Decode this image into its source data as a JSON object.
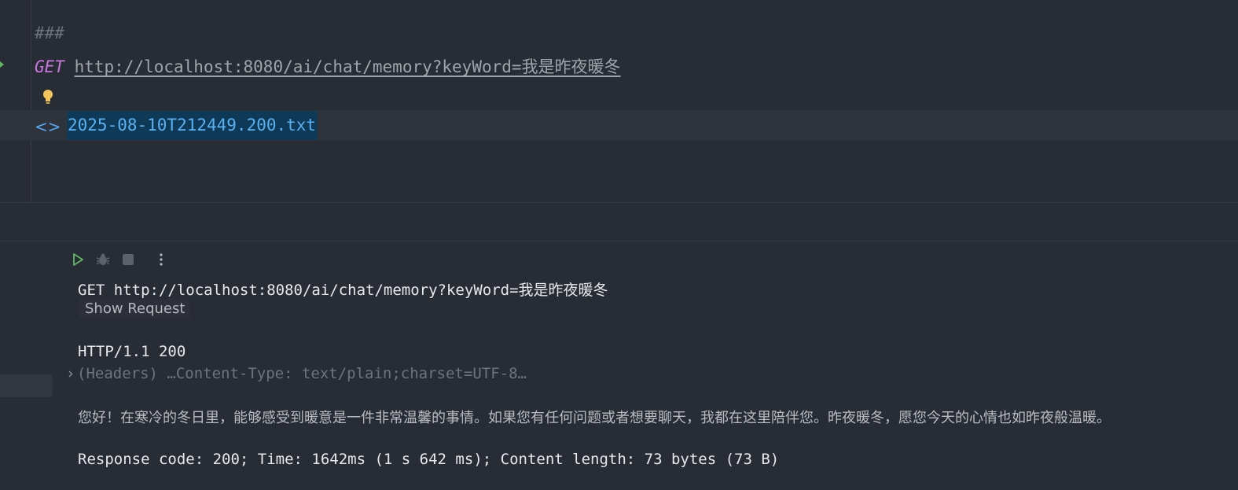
{
  "editor": {
    "separator_comment": "###",
    "request_method": "GET",
    "request_url": "http://localhost:8080/ai/chat/memory?keyWord=我是昨夜暖冬",
    "response_file_icon": "<>",
    "response_file_name": "2025-08-10T212449.200.txt"
  },
  "toolbar": {
    "run_icon": "play-icon",
    "debug_icon": "bug-icon",
    "stop_icon": "stop-icon",
    "more_icon": "more-vertical-icon"
  },
  "response": {
    "request_line": "GET http://localhost:8080/ai/chat/memory?keyWord=我是昨夜暖冬",
    "show_request_label": "Show Request",
    "status_line": "HTTP/1.1 200",
    "headers_summary": "(Headers) …Content-Type: text/plain;charset=UTF-8…",
    "body": "您好！在寒冷的冬日里，能够感受到暖意是一件非常温馨的事情。如果您有任何问题或者想要聊天，我都在这里陪伴您。昨夜暖冬，愿您今天的心情也如昨夜般温暖。",
    "summary": "Response code: 200; Time: 1642ms (1 s 642 ms); Content length: 73 bytes (73 B)"
  },
  "colors": {
    "background": "#282c34",
    "keyword": "#c678dd",
    "link": "#56a8f5",
    "run_green": "#5fb865",
    "bulb_yellow": "#f2c55c"
  }
}
